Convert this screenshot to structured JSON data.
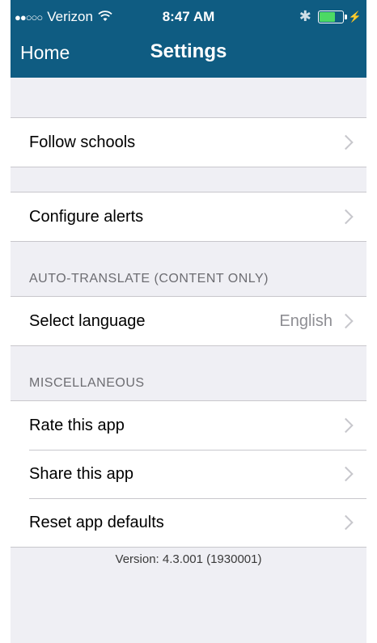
{
  "status_bar": {
    "signal": "●●○○○",
    "carrier": "Verizon",
    "time": "8:47 AM"
  },
  "nav": {
    "back_label": "Home",
    "title": "Settings"
  },
  "groups": {
    "follow": {
      "label": "Follow schools"
    },
    "alerts": {
      "label": "Configure alerts"
    },
    "translate": {
      "header": "AUTO-TRANSLATE (CONTENT ONLY)",
      "language_label": "Select language",
      "language_value": "English"
    },
    "misc": {
      "header": "MISCELLANEOUS",
      "items": [
        {
          "label": "Rate this app"
        },
        {
          "label": "Share this app"
        },
        {
          "label": "Reset app defaults"
        }
      ]
    }
  },
  "footer": {
    "version": "Version: 4.3.001 (1930001)"
  },
  "colors": {
    "nav_bar": "#0f5c82",
    "background": "#efeff4",
    "battery": "#4cd964",
    "chevron": "#c7c7cc",
    "section_header_text": "#6d6d72"
  },
  "icons": [
    "wifi-icon",
    "bluetooth-icon",
    "battery-icon",
    "charging-icon",
    "chevron-right-icon"
  ]
}
